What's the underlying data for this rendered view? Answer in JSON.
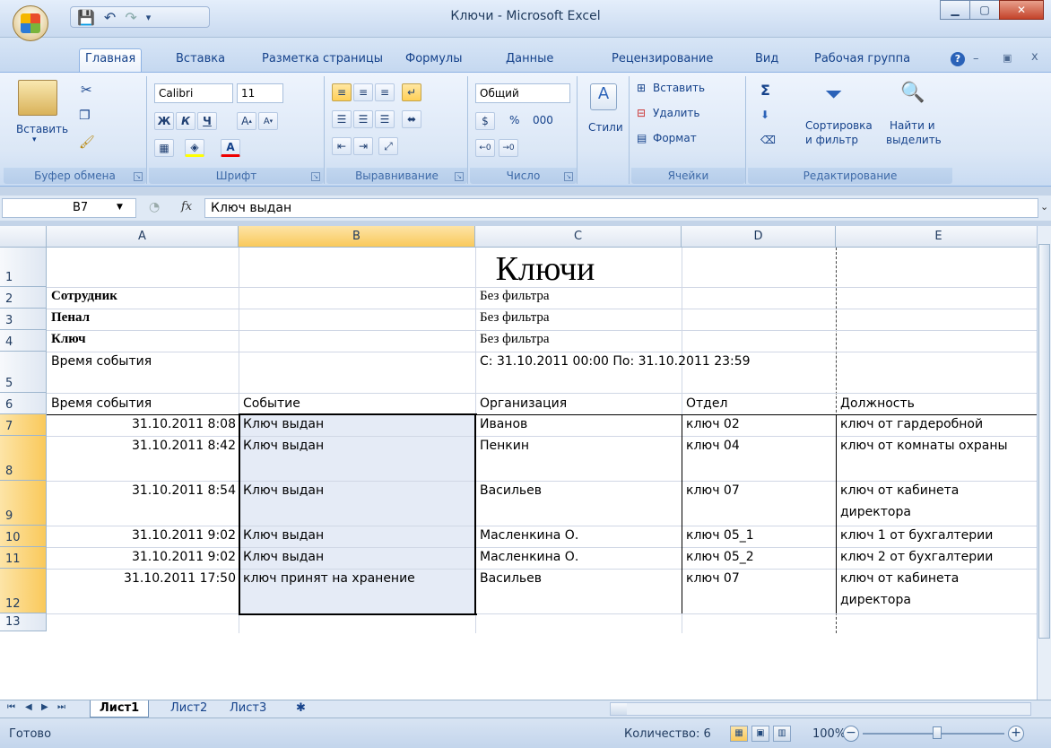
{
  "window": {
    "title": "Ключи - Microsoft Excel"
  },
  "tabs": [
    "Главная",
    "Вставка",
    "Разметка страницы",
    "Формулы",
    "Данные",
    "Рецензирование",
    "Вид",
    "Рабочая группа"
  ],
  "ribbon": {
    "clipboard": {
      "paste": "Вставить",
      "label": "Буфер обмена"
    },
    "font": {
      "name": "Calibri",
      "size": "11",
      "label": "Шрифт",
      "bold": "Ж",
      "italic": "К",
      "underline": "Ч"
    },
    "alignment": {
      "label": "Выравнивание"
    },
    "number": {
      "format": "Общий",
      "label": "Число",
      "percent": "%",
      "thousands": "000"
    },
    "styles": {
      "label": "Стили"
    },
    "cells": {
      "insert": "Вставить",
      "delete": "Удалить",
      "format": "Формат",
      "label": "Ячейки"
    },
    "editing": {
      "sort_line1": "Сортировка",
      "sort_line2": "и фильтр",
      "find_line1": "Найти и",
      "find_line2": "выделить",
      "label": "Редактирование",
      "sigma": "Σ"
    }
  },
  "formula_bar": {
    "cell_ref": "B7",
    "fx": "fx",
    "value": "Ключ выдан"
  },
  "columns": [
    "A",
    "B",
    "C",
    "D",
    "E"
  ],
  "rows": [
    "1",
    "2",
    "3",
    "4",
    "5",
    "6",
    "7",
    "8",
    "9",
    "10",
    "11",
    "12",
    "13"
  ],
  "sheet": {
    "title": "Ключи",
    "filters": [
      {
        "label": "Сотрудник",
        "value": "Без фильтра"
      },
      {
        "label": "Пенал",
        "value": "Без фильтра"
      },
      {
        "label": "Ключ",
        "value": "Без фильтра"
      }
    ],
    "time_label": "Время события",
    "time_value": "С: 31.10.2011 00:00 По: 31.10.2011 23:59",
    "headers": [
      "Время события",
      "Событие",
      "Организация",
      "Отдел",
      "Должность"
    ],
    "data": [
      {
        "time": "31.10.2011 8:08",
        "event": "Ключ выдан",
        "org": "Иванов",
        "dept": "ключ 02",
        "pos": "ключ от гардеробной",
        "pos2": ""
      },
      {
        "time": "31.10.2011 8:42",
        "event": "Ключ выдан",
        "org": "Пенкин",
        "dept": "ключ 04",
        "pos": "ключ от комнаты охраны",
        "pos2": ""
      },
      {
        "time": "31.10.2011 8:54",
        "event": "Ключ выдан",
        "org": "Васильев",
        "dept": "ключ 07",
        "pos": "ключ от кабинета",
        "pos2": "директора"
      },
      {
        "time": "31.10.2011 9:02",
        "event": "Ключ выдан",
        "org": "Масленкина О.",
        "dept": "ключ 05_1",
        "pos": "ключ 1 от бухгалтерии",
        "pos2": ""
      },
      {
        "time": "31.10.2011 9:02",
        "event": "Ключ выдан",
        "org": "Масленкина О.",
        "dept": "ключ 05_2",
        "pos": "ключ 2 от бухгалтерии",
        "pos2": ""
      },
      {
        "time": "31.10.2011 17:50",
        "event": "ключ принят на хранение",
        "org": "Васильев",
        "dept": "ключ 07",
        "pos": "ключ от кабинета",
        "pos2": "директора"
      }
    ]
  },
  "sheet_tabs": [
    "Лист1",
    "Лист2",
    "Лист3"
  ],
  "status": {
    "ready": "Готово",
    "count": "Количество: 6",
    "zoom": "100%"
  }
}
